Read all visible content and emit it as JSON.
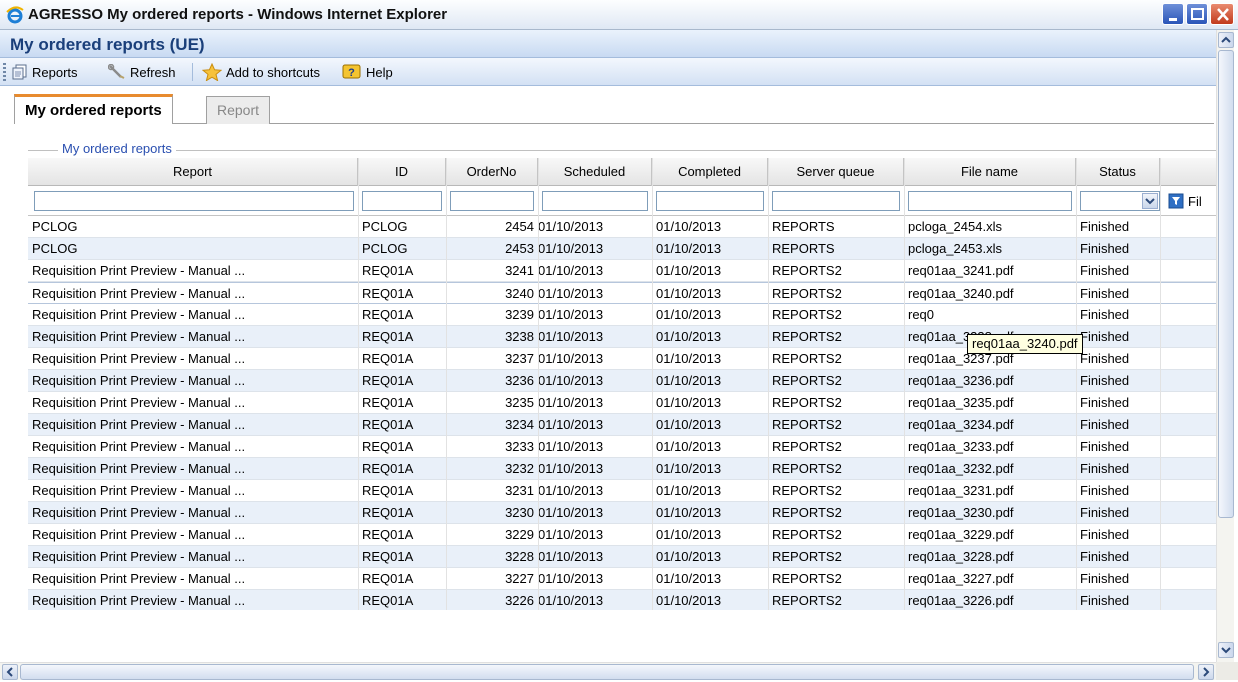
{
  "window": {
    "title": "AGRESSO My ordered reports - Windows Internet Explorer"
  },
  "app": {
    "title": "My ordered reports (UE)"
  },
  "toolbar": {
    "reports_label": "Reports",
    "refresh_label": "Refresh",
    "shortcuts_label": "Add to shortcuts",
    "help_label": "Help"
  },
  "tabs": [
    {
      "label": "My ordered reports",
      "active": true
    },
    {
      "label": "Report",
      "active": false
    }
  ],
  "section": {
    "legend": "My ordered reports"
  },
  "grid": {
    "columns": [
      "Report",
      "ID",
      "OrderNo",
      "Scheduled",
      "Completed",
      "Server queue",
      "File name",
      "Status"
    ],
    "filter_button_label": "Fil",
    "rows": [
      [
        "PCLOG",
        "PCLOG",
        "2454",
        "01/10/2013",
        "01/10/2013",
        "REPORTS",
        "pcloga_2454.xls",
        "Finished"
      ],
      [
        "PCLOG",
        "PCLOG",
        "2453",
        "01/10/2013",
        "01/10/2013",
        "REPORTS",
        "pcloga_2453.xls",
        "Finished"
      ],
      [
        "Requisition Print Preview - Manual ...",
        "REQ01A",
        "3241",
        "01/10/2013",
        "01/10/2013",
        "REPORTS2",
        "req01aa_3241.pdf",
        "Finished"
      ],
      [
        "Requisition Print Preview - Manual ...",
        "REQ01A",
        "3240",
        "01/10/2013",
        "01/10/2013",
        "REPORTS2",
        "req01aa_3240.pdf",
        "Finished"
      ],
      [
        "Requisition Print Preview - Manual ...",
        "REQ01A",
        "3239",
        "01/10/2013",
        "01/10/2013",
        "REPORTS2",
        "req0",
        "Finished"
      ],
      [
        "Requisition Print Preview - Manual ...",
        "REQ01A",
        "3238",
        "01/10/2013",
        "01/10/2013",
        "REPORTS2",
        "req01aa_3238.pdf",
        "Finished"
      ],
      [
        "Requisition Print Preview - Manual ...",
        "REQ01A",
        "3237",
        "01/10/2013",
        "01/10/2013",
        "REPORTS2",
        "req01aa_3237.pdf",
        "Finished"
      ],
      [
        "Requisition Print Preview - Manual ...",
        "REQ01A",
        "3236",
        "01/10/2013",
        "01/10/2013",
        "REPORTS2",
        "req01aa_3236.pdf",
        "Finished"
      ],
      [
        "Requisition Print Preview - Manual ...",
        "REQ01A",
        "3235",
        "01/10/2013",
        "01/10/2013",
        "REPORTS2",
        "req01aa_3235.pdf",
        "Finished"
      ],
      [
        "Requisition Print Preview - Manual ...",
        "REQ01A",
        "3234",
        "01/10/2013",
        "01/10/2013",
        "REPORTS2",
        "req01aa_3234.pdf",
        "Finished"
      ],
      [
        "Requisition Print Preview - Manual ...",
        "REQ01A",
        "3233",
        "01/10/2013",
        "01/10/2013",
        "REPORTS2",
        "req01aa_3233.pdf",
        "Finished"
      ],
      [
        "Requisition Print Preview - Manual ...",
        "REQ01A",
        "3232",
        "01/10/2013",
        "01/10/2013",
        "REPORTS2",
        "req01aa_3232.pdf",
        "Finished"
      ],
      [
        "Requisition Print Preview - Manual ...",
        "REQ01A",
        "3231",
        "01/10/2013",
        "01/10/2013",
        "REPORTS2",
        "req01aa_3231.pdf",
        "Finished"
      ],
      [
        "Requisition Print Preview - Manual ...",
        "REQ01A",
        "3230",
        "01/10/2013",
        "01/10/2013",
        "REPORTS2",
        "req01aa_3230.pdf",
        "Finished"
      ],
      [
        "Requisition Print Preview - Manual ...",
        "REQ01A",
        "3229",
        "01/10/2013",
        "01/10/2013",
        "REPORTS2",
        "req01aa_3229.pdf",
        "Finished"
      ],
      [
        "Requisition Print Preview - Manual ...",
        "REQ01A",
        "3228",
        "01/10/2013",
        "01/10/2013",
        "REPORTS2",
        "req01aa_3228.pdf",
        "Finished"
      ],
      [
        "Requisition Print Preview - Manual ...",
        "REQ01A",
        "3227",
        "01/10/2013",
        "01/10/2013",
        "REPORTS2",
        "req01aa_3227.pdf",
        "Finished"
      ],
      [
        "Requisition Print Preview - Manual ...",
        "REQ01A",
        "3226",
        "01/10/2013",
        "01/10/2013",
        "REPORTS2",
        "req01aa_3226.pdf",
        "Finished"
      ]
    ]
  },
  "tooltip": {
    "text": "req01aa_3240.pdf"
  },
  "colors": {
    "accent_tab": "#e88b2e",
    "title_blue": "#1a3f7a",
    "legend_blue": "#2a4fb0",
    "row_alt": "#e9f0f9"
  },
  "icons": {
    "window": "internet-explorer-icon",
    "reports": "reports-icon",
    "refresh": "wrench-icon",
    "shortcuts": "star-icon",
    "help": "help-icon",
    "filter": "filter-icon"
  }
}
